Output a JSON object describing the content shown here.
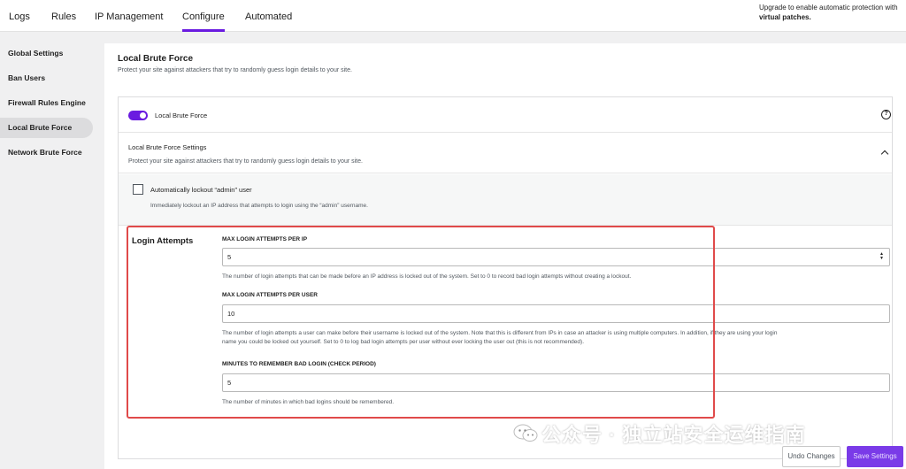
{
  "tabs": [
    {
      "label": "Logs",
      "active": false
    },
    {
      "label": "Rules",
      "active": false
    },
    {
      "label": "IP Management",
      "active": false
    },
    {
      "label": "Configure",
      "active": true
    },
    {
      "label": "Automated",
      "active": false
    }
  ],
  "promo": {
    "line1": "Upgrade to enable automatic protection with",
    "line2": "virtual patches."
  },
  "sidebar": {
    "items": [
      {
        "label": "Global Settings",
        "active": false
      },
      {
        "label": "Ban Users",
        "active": false
      },
      {
        "label": "Firewall Rules Engine",
        "active": false
      },
      {
        "label": "Local Brute Force",
        "active": true
      },
      {
        "label": "Network Brute Force",
        "active": false
      }
    ]
  },
  "main": {
    "title": "Local Brute Force",
    "description": "Protect your site against attackers that try to randomly guess login details to your site.",
    "toggle": {
      "label": "Local Brute Force",
      "on": true
    },
    "settings": {
      "title": "Local Brute Force Settings",
      "description": "Protect your site against attackers that try to randomly guess login details to your site."
    },
    "lockout": {
      "label": "Automatically lockout “admin” user",
      "description": "Immediately lockout an IP address that attempts to login using the “admin” username.",
      "checked": false
    },
    "login_attempts": {
      "title": "Login Attempts",
      "fields": [
        {
          "label": "MAX LOGIN ATTEMPTS PER IP",
          "value": "5",
          "help": "The number of login attempts that can be made before an IP address is locked out of the system. Set to 0 to record bad login attempts without creating a lockout."
        },
        {
          "label": "MAX LOGIN ATTEMPTS PER USER",
          "value": "10",
          "help_line1": "The number of login attempts a user can make before their username is locked out of the system. Note that this is different from IPs in case an attacker is using multiple computers. In addition, if they are using your login",
          "help_line2": "name you could be locked out yourself. Set to 0 to log bad login attempts per user without ever locking the user out (this is not recommended)."
        },
        {
          "label": "MINUTES TO REMEMBER BAD LOGIN (CHECK PERIOD)",
          "value": "5",
          "help": "The number of minutes in which bad logins should be remembered."
        }
      ]
    }
  },
  "watermark": "公众号 · 独立站安全运维指南",
  "footer": {
    "undo_label": "Undo Changes",
    "save_label": "Save Settings"
  },
  "colors": {
    "accent": "#6a1be0",
    "highlight": "#e04a4a"
  }
}
